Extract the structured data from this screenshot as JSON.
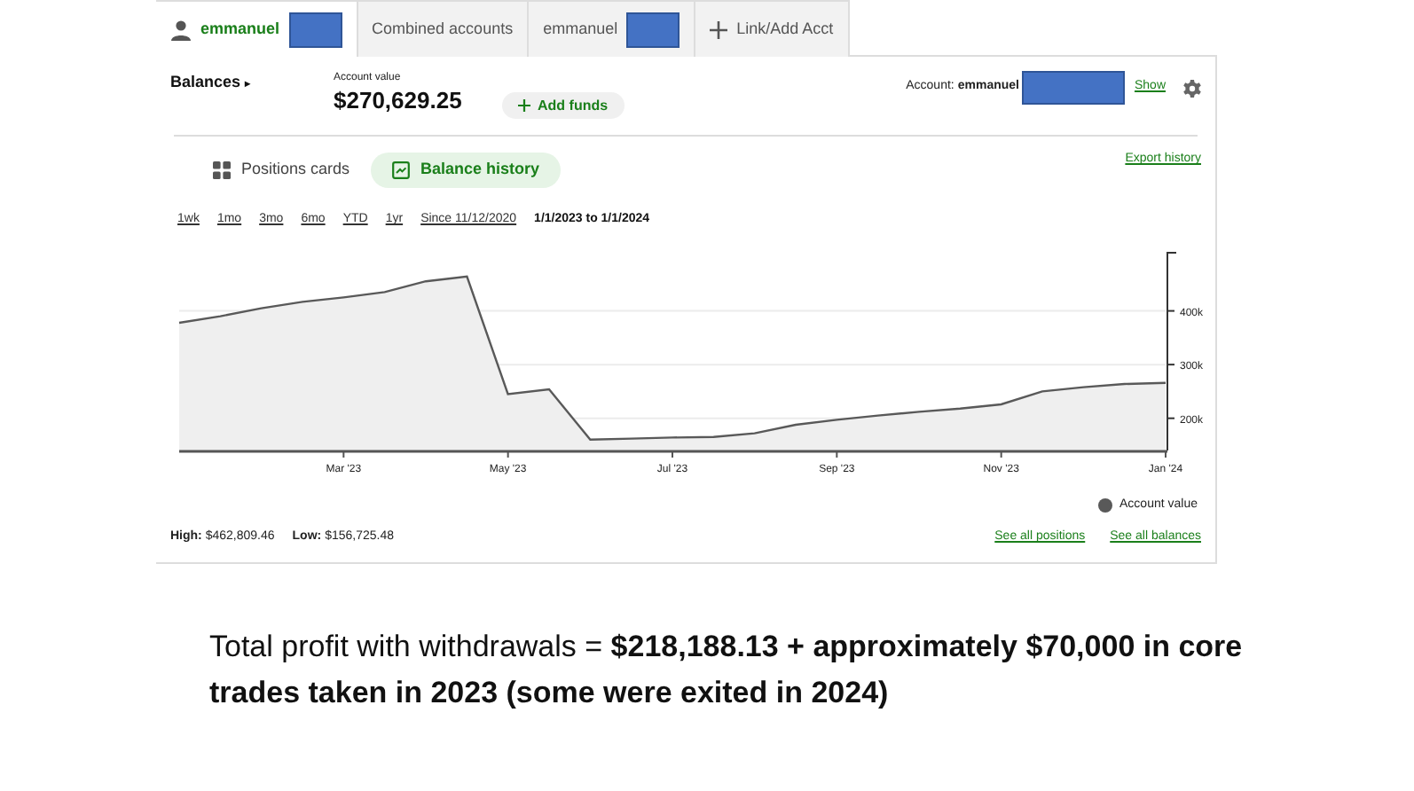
{
  "tabs": [
    {
      "kind": "user",
      "label": "emmanuel",
      "selected": true
    },
    {
      "kind": "plain",
      "label": "Combined accounts",
      "selected": false
    },
    {
      "kind": "masked",
      "label": "emmanuel",
      "selected": false
    },
    {
      "kind": "add",
      "label": "Link/Add Acct",
      "selected": false
    }
  ],
  "header": {
    "balances": "Balances",
    "balances_caret": "▸",
    "account_value_label": "Account value",
    "account_value": "$270,629.25",
    "add_funds": "Add funds",
    "account_label": "Account:",
    "account_name": "emmanuel",
    "show": "Show"
  },
  "views": [
    {
      "kind": "cards",
      "label": "Positions cards",
      "selected": false
    },
    {
      "kind": "history",
      "label": "Balance history",
      "selected": true
    }
  ],
  "export": "Export history",
  "periods": [
    {
      "label": "1wk",
      "selected": false
    },
    {
      "label": "1mo",
      "selected": false
    },
    {
      "label": "3mo",
      "selected": false
    },
    {
      "label": "6mo",
      "selected": false
    },
    {
      "label": "YTD",
      "selected": false
    },
    {
      "label": "1yr",
      "selected": false
    },
    {
      "label": "Since 11/12/2020",
      "selected": false
    },
    {
      "label": "1/1/2023 to 1/1/2024",
      "selected": true
    }
  ],
  "chart_data": {
    "type": "area",
    "grid": true,
    "categories": [
      null,
      null,
      null,
      null,
      "Mar '23",
      null,
      null,
      null,
      "May '23",
      null,
      null,
      null,
      "Jul '23",
      null,
      null,
      null,
      "Sep '23",
      null,
      null,
      null,
      "Nov '23",
      null,
      null,
      null,
      "Jan '24"
    ],
    "series": [
      {
        "name": "Account value",
        "color": "#595959",
        "values": [
          378000,
          390000,
          405000,
          417000,
          425000,
          435000,
          455000,
          464000,
          245000,
          254000,
          160000,
          162000,
          164000,
          165000,
          172000,
          188000,
          197000,
          205000,
          212000,
          218000,
          226000,
          250000,
          258000,
          264000,
          266000
        ]
      }
    ],
    "ylim": [
      140000,
      510000
    ],
    "yticks": [
      {
        "value": 200000,
        "label": "200k"
      },
      {
        "value": 300000,
        "label": "300k"
      },
      {
        "value": 400000,
        "label": "400k"
      }
    ]
  },
  "stats": [
    {
      "label": "High:",
      "value": "$462,809.46"
    },
    {
      "label": "Low:",
      "value": "$156,725.48"
    }
  ],
  "links": [
    "See all positions",
    "See all balances"
  ],
  "caption": "Total profit with withdrawals = **$218,188.13 + approximately $70,000 in core trades taken in 2023 (some were exited in 2024)**"
}
